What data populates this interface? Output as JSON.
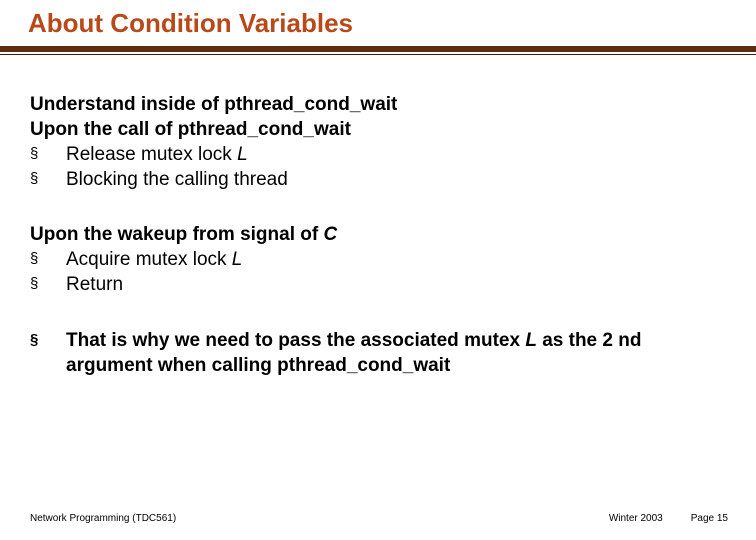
{
  "title": "About Condition Variables",
  "section1": {
    "heading1": "Understand inside of pthread_cond_wait",
    "heading2": "Upon the call of pthread_cond_wait",
    "bullet1_pre": "Release mutex lock ",
    "bullet1_em": "L",
    "bullet2": "Blocking the calling thread"
  },
  "section2": {
    "heading_pre": "Upon the wakeup from signal of ",
    "heading_em": "C",
    "bullet1_pre": "Acquire mutex lock ",
    "bullet1_em": "L",
    "bullet2": "Return"
  },
  "section3": {
    "bullet_pre": "That is why we need to pass the associated mutex ",
    "bullet_em": "L",
    "bullet_post": " as the 2 nd argument when calling pthread_cond_wait"
  },
  "footer": {
    "left": "Network Programming (TDC561)",
    "mid": "Winter 2003",
    "right": "Page 15"
  },
  "bullet_glyph": "§"
}
